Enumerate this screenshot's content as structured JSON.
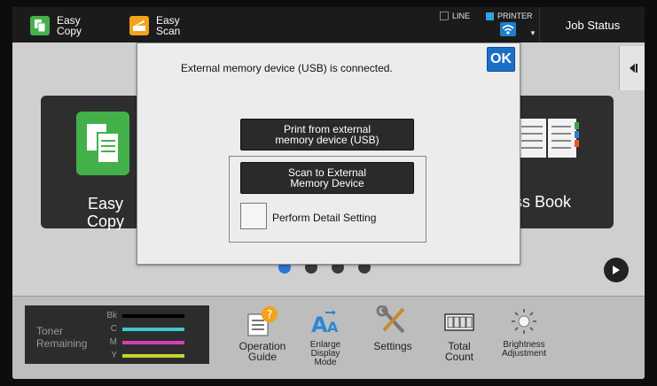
{
  "topbar": {
    "easy_copy": "Easy\nCopy",
    "easy_scan": "Easy\nScan",
    "line": "LINE",
    "printer": "PRINTER",
    "job_status": "Job Status"
  },
  "home": {
    "left_tile_label": "Easy\nCopy",
    "right_tile_label": "dress Book",
    "page_dots": 4,
    "active_dot": 0
  },
  "dialog": {
    "message": "External memory device (USB) is connected.",
    "ok_label": "OK",
    "print_btn": "Print from external\nmemory device (USB)",
    "scan_btn": "Scan to External\nMemory Device",
    "detail_label": "Perform Detail Setting"
  },
  "toner": {
    "title": "Toner\nRemaining",
    "rows": [
      {
        "label": "Bk",
        "color": "#000000"
      },
      {
        "label": "C",
        "color": "#3fc7d0"
      },
      {
        "label": "M",
        "color": "#d43fb8"
      },
      {
        "label": "Y",
        "color": "#c7d42e"
      }
    ]
  },
  "bottom": {
    "operation_guide": "Operation\nGuide",
    "enlarge": "Enlarge\nDisplay\nMode",
    "settings": "Settings",
    "total_count": "Total\nCount",
    "brightness": "Brightness\nAdjustment"
  },
  "icons": {
    "copy": "copy-icon",
    "scan": "scan-icon",
    "wifi": "wifi-icon",
    "book": "address-book-icon",
    "next": "play-icon",
    "collapse": "collapse-icon"
  },
  "colors": {
    "accent": "#1c6fc9",
    "copy_green": "#44b04a",
    "scan_orange": "#f2a21b"
  }
}
